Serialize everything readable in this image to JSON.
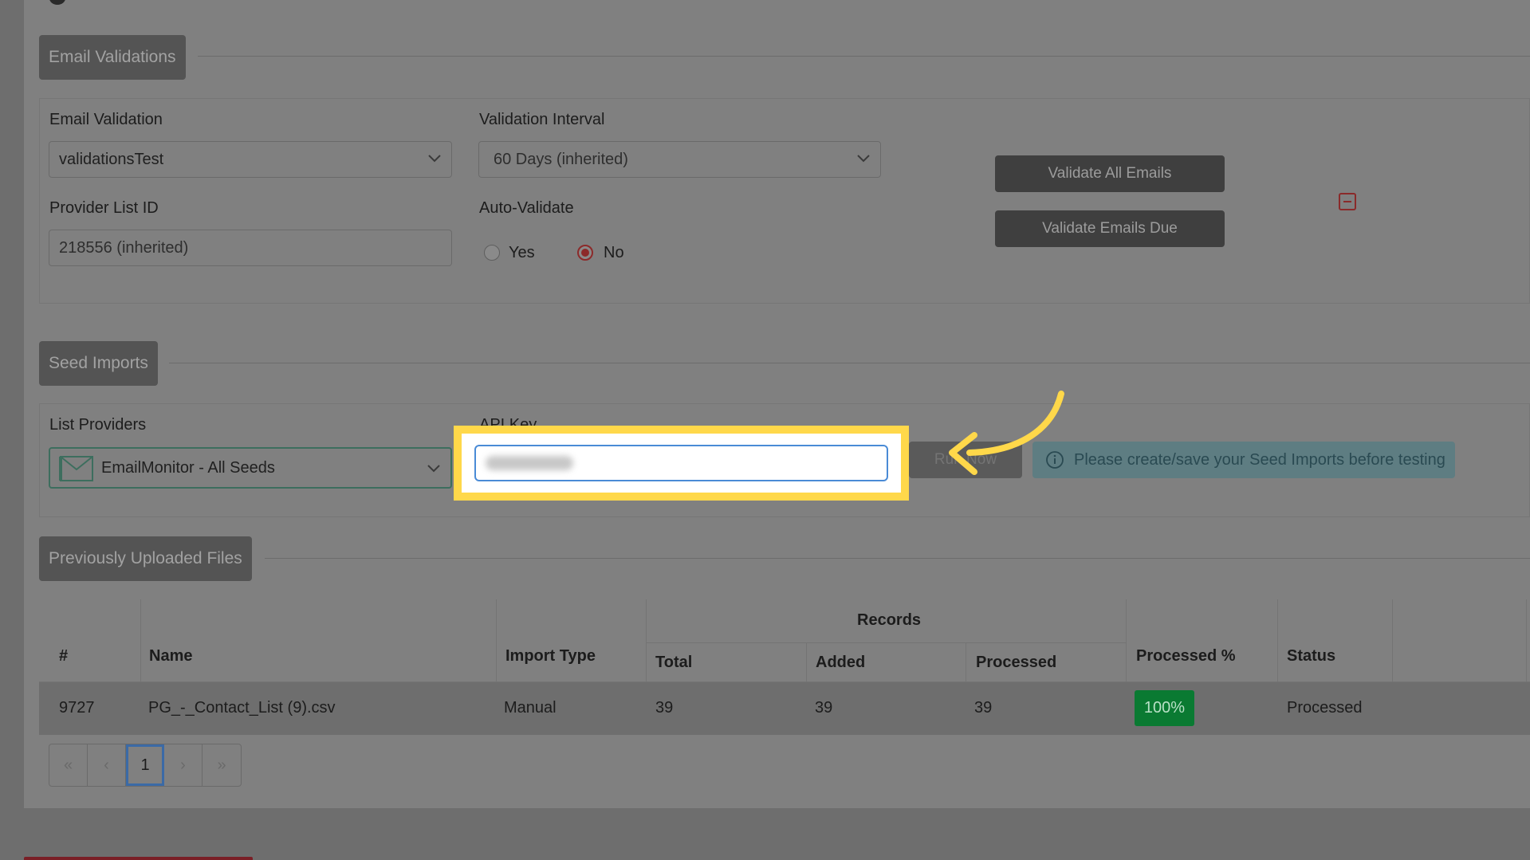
{
  "email_validations": {
    "section_title": "Email Validations",
    "email_validation_label": "Email Validation",
    "email_validation_value": "validationsTest",
    "validation_interval_label": "Validation Interval",
    "validation_interval_value": "60 Days (inherited)",
    "provider_list_id_label": "Provider List ID",
    "provider_list_id_value": "218556 (inherited)",
    "auto_validate_label": "Auto-Validate",
    "auto_validate_yes": "Yes",
    "auto_validate_no": "No",
    "auto_validate_selected": "No",
    "validate_all_label": "Validate All Emails",
    "validate_due_label": "Validate Emails Due"
  },
  "seed_imports": {
    "section_title": "Seed Imports",
    "list_providers_label": "List Providers",
    "list_providers_value": "EmailMonitor - All Seeds",
    "api_key_label": "API Key",
    "run_now_label": "Run Now",
    "info_message": "Please create/save your Seed Imports before testing"
  },
  "files": {
    "section_title": "Previously Uploaded Files",
    "headers": {
      "num": "#",
      "name": "Name",
      "import_type": "Import Type",
      "records": "Records",
      "total": "Total",
      "added": "Added",
      "processed": "Processed",
      "processed_pct": "Processed %",
      "status": "Status"
    },
    "rows": [
      {
        "num": "9727",
        "name": "PG_-_Contact_List (9).csv",
        "import_type": "Manual",
        "total": "39",
        "added": "39",
        "processed": "39",
        "processed_pct": "100%",
        "status": "Processed"
      }
    ],
    "pagination": {
      "first": "«",
      "prev": "‹",
      "current": "1",
      "next": "›",
      "last": "»"
    }
  },
  "colors": {
    "highlight": "#ffd84a",
    "arrow": "#ffd84a",
    "badge_green": "#0a7a32",
    "radio_red": "#8c2a2a"
  }
}
